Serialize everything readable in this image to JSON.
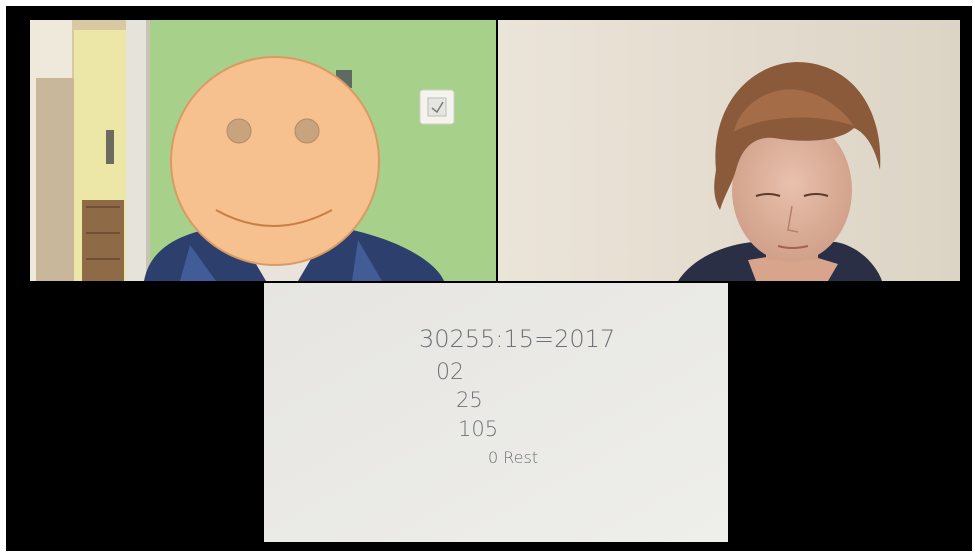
{
  "window": {
    "title": ""
  },
  "participants": [
    {
      "name": "",
      "avatar_overlay": "smiley-face-icon"
    },
    {
      "name": ""
    },
    {
      "name": ""
    }
  ],
  "whiteboard": {
    "lines": [
      "30255:15=2017",
      "02",
      "25",
      "105",
      "0 Rest"
    ]
  },
  "colors": {
    "background": "#000000",
    "smiley_fill": "#f6c08f",
    "smiley_stroke": "#d99b62",
    "wall_green": "#a7d08a",
    "wall_beige": "#e7e0d4",
    "paper": "#e8e7e3"
  }
}
